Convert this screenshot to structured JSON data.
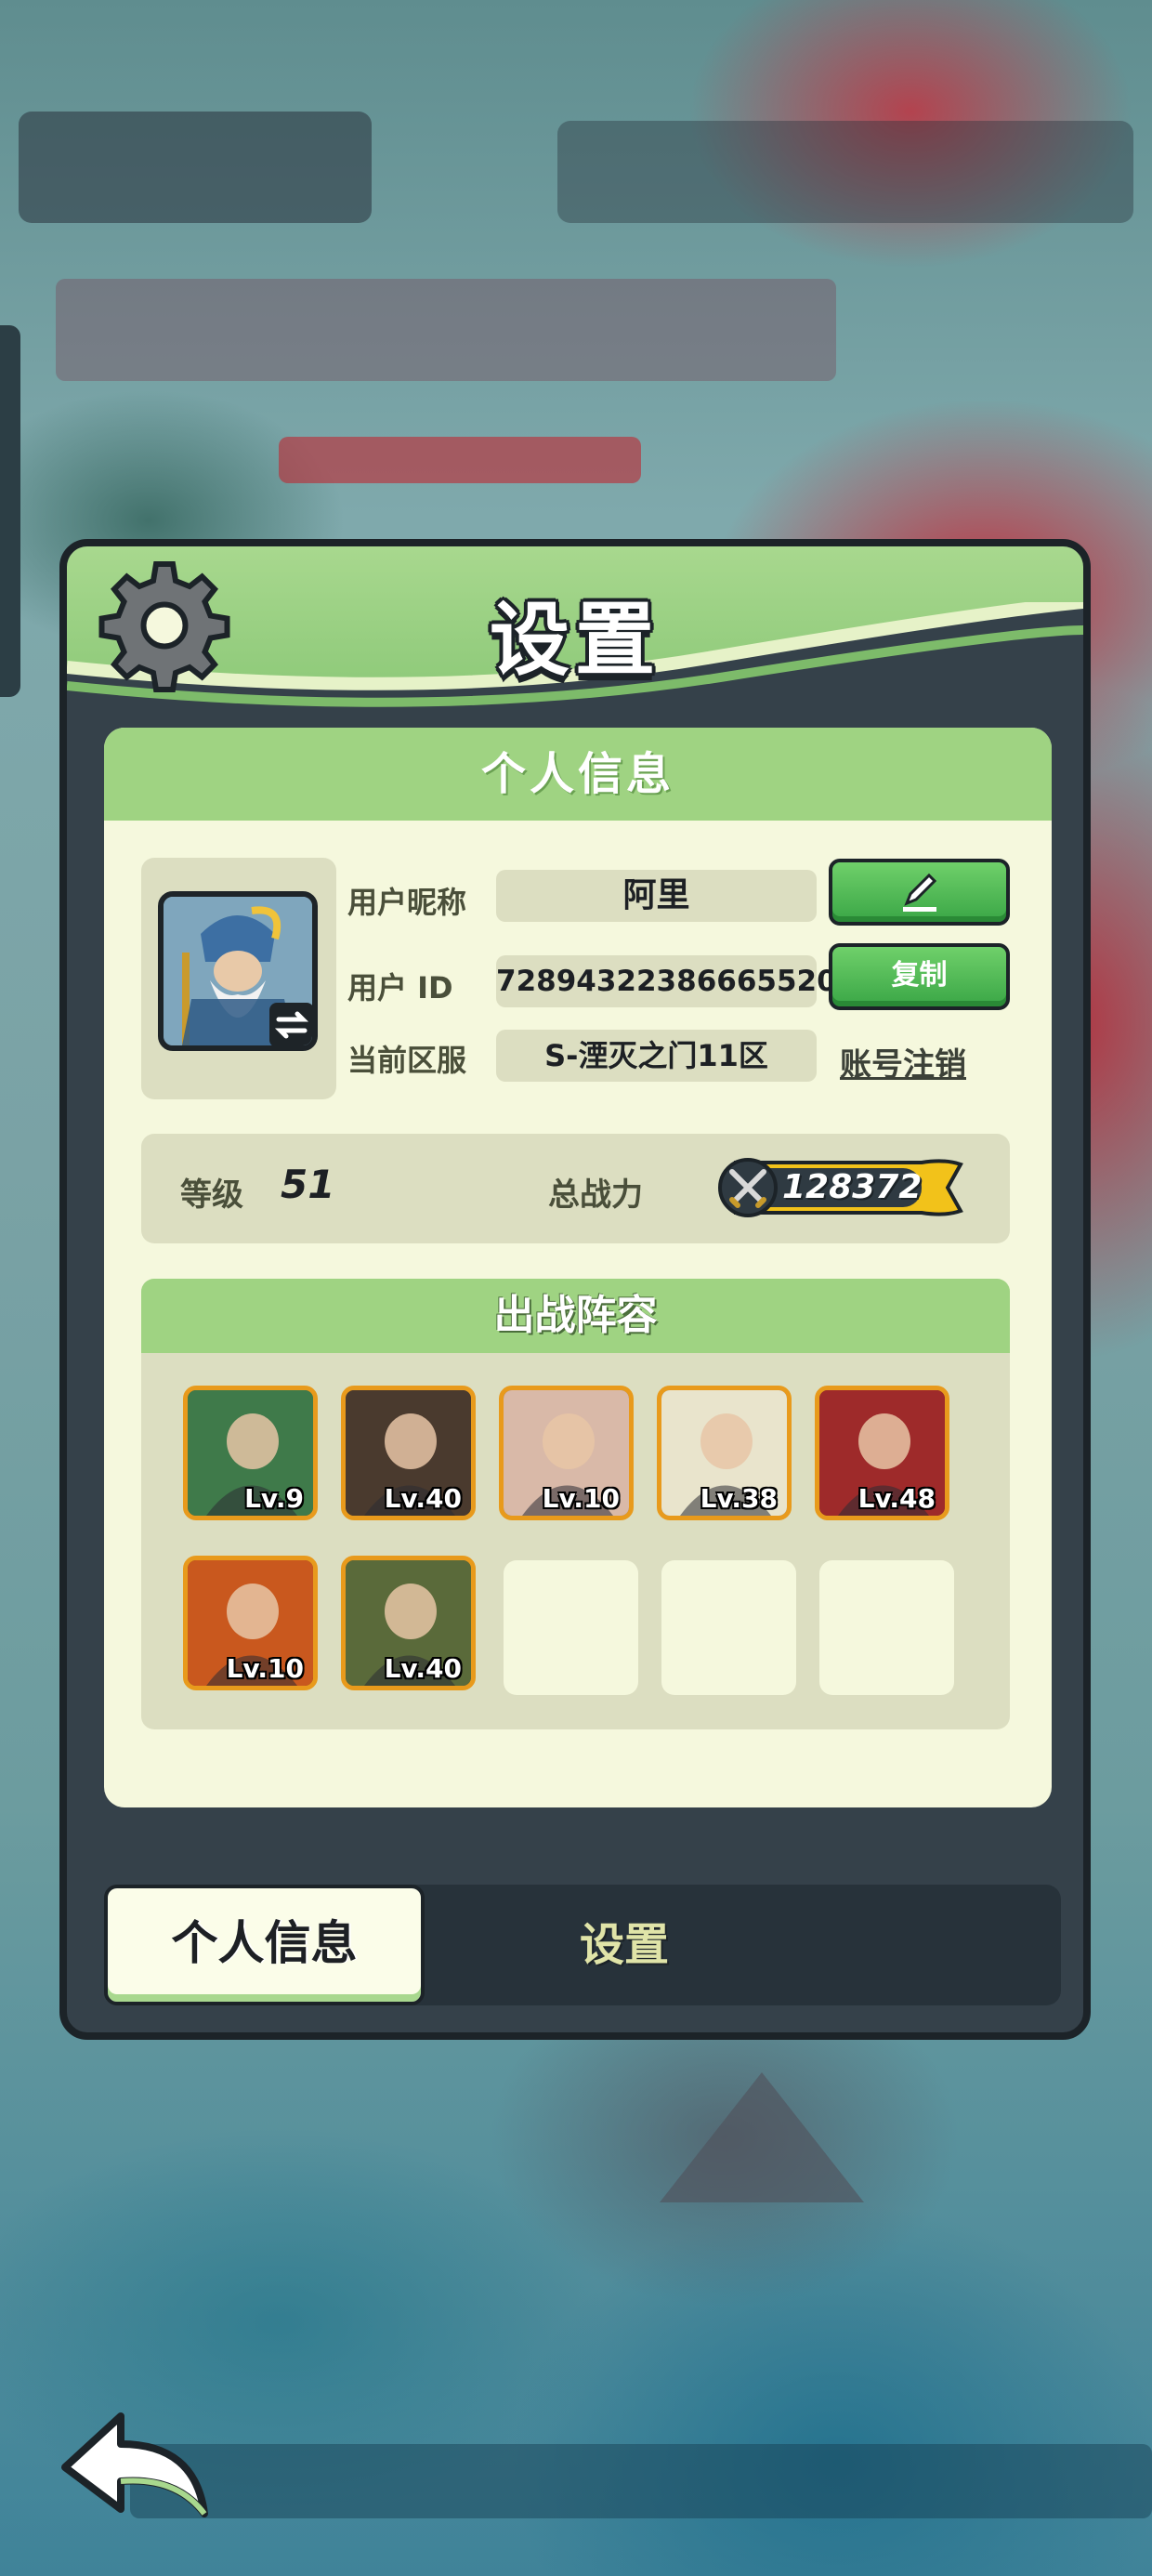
{
  "dialog": {
    "title": "设置"
  },
  "card": {
    "header": "个人信息",
    "nickname_label": "用户昵称",
    "nickname_value": "阿里",
    "uid_label": "用户   ID",
    "uid_value": "72894322386665520",
    "copy_label": "复制",
    "server_label": "当前区服",
    "server_value": "S-湮灭之门11区",
    "logout_label": "账号注销",
    "level_label": "等级",
    "level_value": "51",
    "power_label": "总战力",
    "power_value": "128372"
  },
  "lineup": {
    "header": "出战阵容",
    "heroes": [
      {
        "level": "Lv.9",
        "color": "#3f7a4a"
      },
      {
        "level": "Lv.40",
        "color": "#4a3a2e"
      },
      {
        "level": "Lv.10",
        "color": "#d9b9a8"
      },
      {
        "level": "Lv.38",
        "color": "#e9e4cc"
      },
      {
        "level": "Lv.48",
        "color": "#9e2a2a"
      },
      {
        "level": "Lv.10",
        "color": "#c9581e"
      },
      {
        "level": "Lv.40",
        "color": "#5a6a3a"
      }
    ]
  },
  "tabs": {
    "active": "个人信息",
    "inactive": "设置"
  },
  "colors": {
    "panel_green": "#9fd382",
    "button_green": "#3aa646",
    "card_bg": "#f5f8dd",
    "hero_border": "#e89a1c"
  },
  "icons": [
    "gear-icon",
    "edit-pencil-icon",
    "swap-icon",
    "crossed-swords-icon",
    "back-arrow-icon"
  ]
}
